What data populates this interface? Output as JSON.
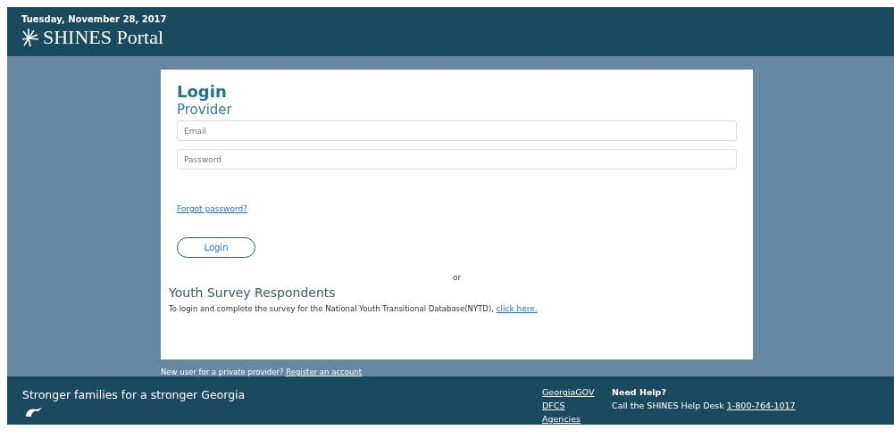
{
  "header": {
    "date": "Tuesday, November 28, 2017",
    "title": "SHINES Portal"
  },
  "login": {
    "title": "Login",
    "subtitle": "Provider",
    "fields": [
      {
        "placeholder": "Email"
      },
      {
        "placeholder": "Password"
      }
    ],
    "forgot_link": "Forgot password?",
    "button": "Login",
    "or": "or",
    "youth": {
      "title": "Youth Survey Respondents",
      "text": "To login and complete the survey for the National Youth Transitional Database(NYTD),",
      "link": "click here."
    }
  },
  "register": {
    "text": "New user for a private provider?",
    "link": "Register an account"
  },
  "footer": {
    "slogan": "Stronger families for a stronger Georgia",
    "links": [
      "GeorgiaGOV",
      "DFCS",
      "Agencies"
    ],
    "help_title": "Need Help?",
    "help_text": "Call the SHINES Help Desk",
    "phone": "1-800-764-1017"
  }
}
